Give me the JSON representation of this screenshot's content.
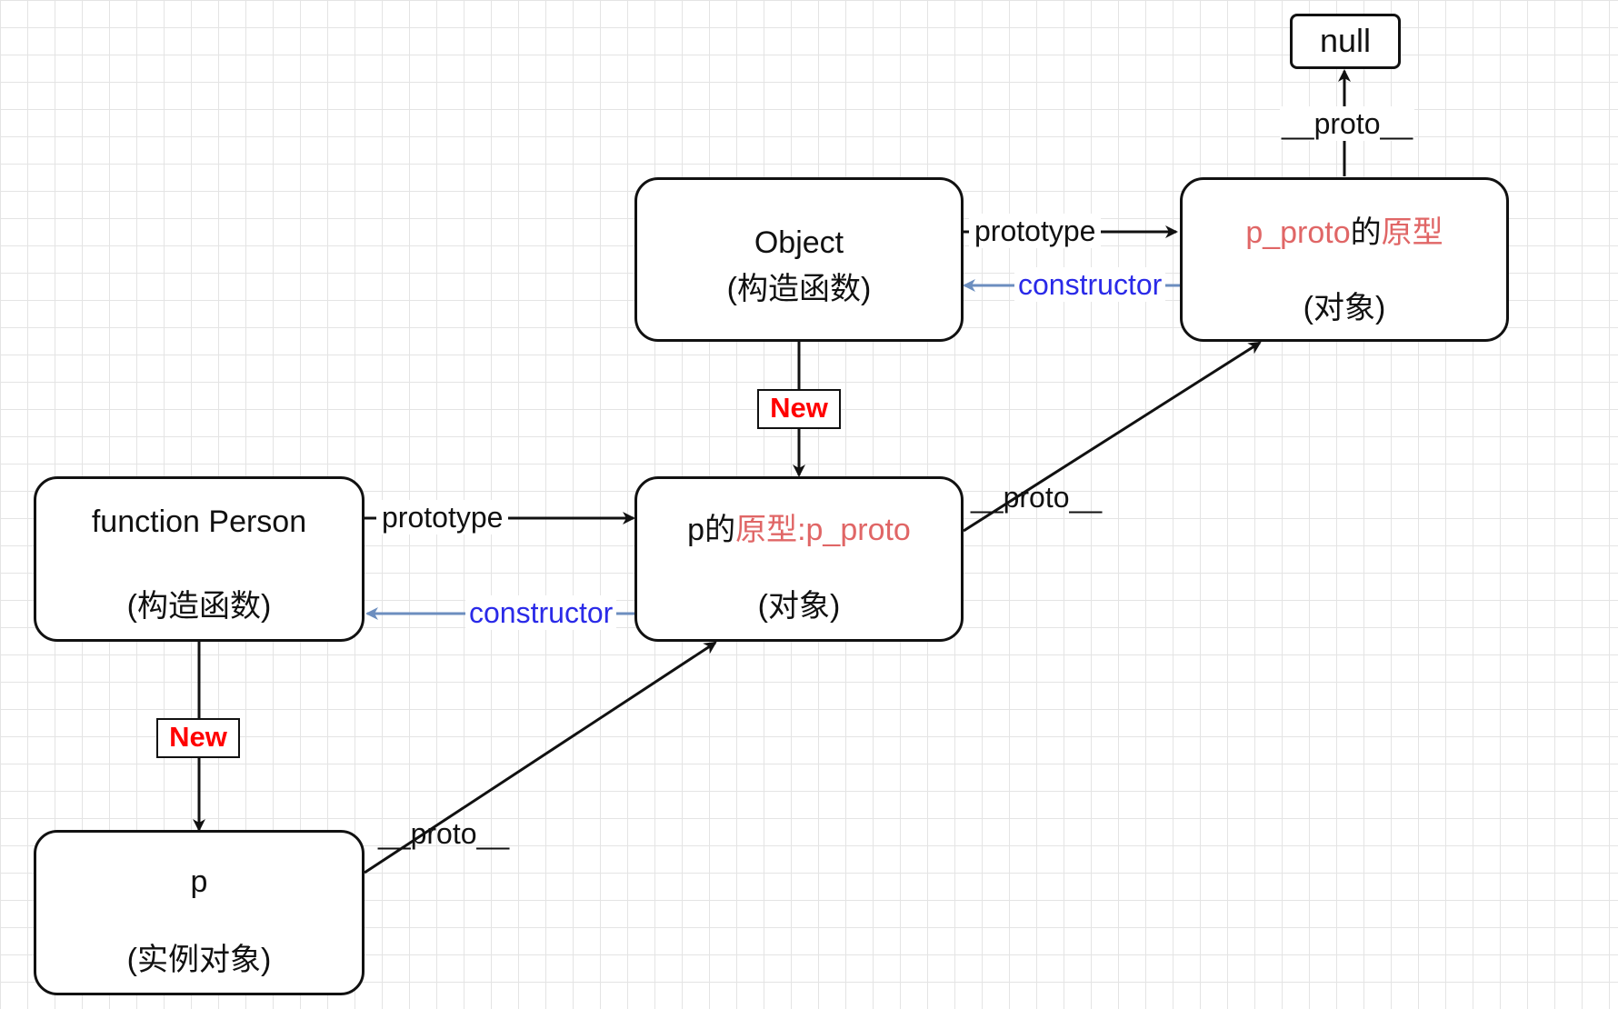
{
  "nodes": {
    "object_ctor": {
      "line1": "Object",
      "line2": "(构造函数)"
    },
    "p_proto_proto": {
      "line1_red_a": "p_proto",
      "line1_black": "的",
      "line1_red_b": "原型",
      "line2": "(对象)"
    },
    "null_node": {
      "label": "null"
    },
    "person_ctor": {
      "line1": "function Person",
      "line2": "(构造函数)"
    },
    "p_proto": {
      "line1_black": "p的",
      "line1_red": "原型:p_proto",
      "line2": "(对象)"
    },
    "p_instance": {
      "line1": "p",
      "line2": "(实例对象)"
    }
  },
  "edges": {
    "object_prototype": "prototype",
    "object_constructor": "constructor",
    "p_proto_proto_to_null": "__proto__",
    "object_new": "New",
    "p_proto_to_proto_proto": "__proto__",
    "person_prototype": "prototype",
    "person_constructor": "constructor",
    "person_new": "New",
    "p_to_p_proto": "__proto__"
  },
  "colors": {
    "accent_red": "#e06666",
    "constructor_text": "#2a2ae8",
    "constructor_line": "#6c8ebf",
    "new_text": "#ff0000"
  }
}
